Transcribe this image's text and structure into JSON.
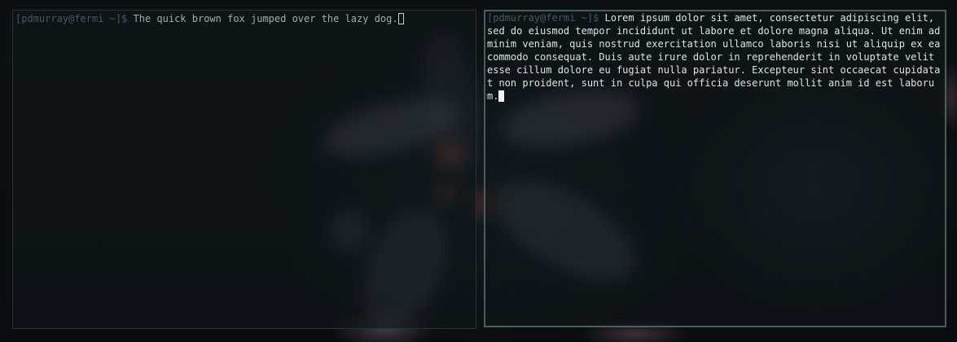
{
  "theme": {
    "prompt_color": "#47595f",
    "inactive_text_color": "#a3aaac",
    "active_text_color": "#dfe3e2",
    "active_border_color": "#4d5b62",
    "inactive_border_color": "#26323a"
  },
  "terminals": [
    {
      "focused": false,
      "prompt": "[pdmurray@fermi ~]$ ",
      "command": "The quick brown fox jumped over the lazy dog."
    },
    {
      "focused": true,
      "prompt": "[pdmurray@fermi ~]$ ",
      "command": "Lorem ipsum dolor sit amet, consectetur adipiscing elit, sed do eiusmod tempor incididunt ut labore et dolore magna aliqua. Ut enim ad minim veniam, quis nostrud exercitation ullamco laboris nisi ut aliquip ex ea commodo consequat. Duis aute irure dolor in reprehenderit in voluptate velit esse cillum dolore eu fugiat nulla pariatur. Excepteur sint occaecat cupidatat non proident, sunt in culpa qui officia deserunt mollit anim id est laborum."
    }
  ]
}
